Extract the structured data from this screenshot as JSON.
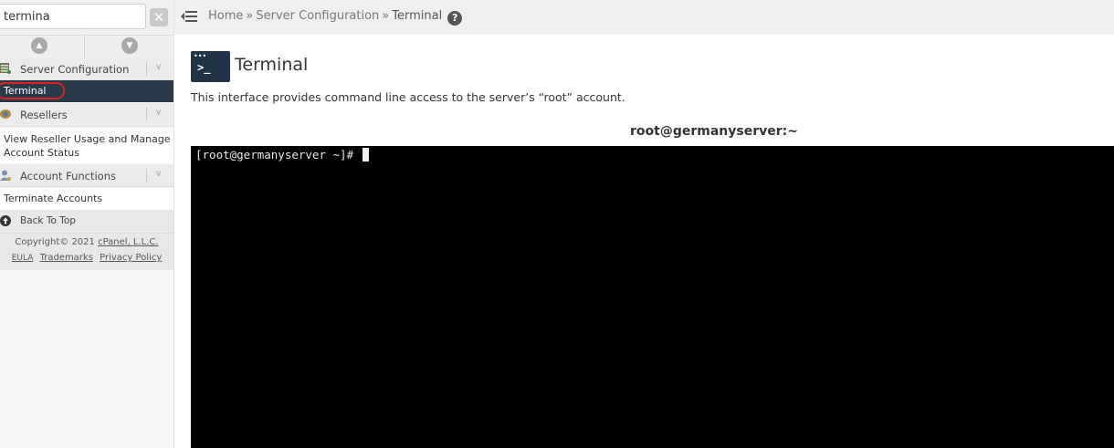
{
  "search": {
    "value": "termina",
    "clear_label": "✕"
  },
  "sidebar": {
    "collapse_up": "▲",
    "collapse_down": "▼",
    "categories": [
      {
        "label": "Server Configuration",
        "chevron": "∨",
        "icon": "server-config-icon",
        "items": [
          "Terminal"
        ]
      },
      {
        "label": "Resellers",
        "chevron": "∨",
        "icon": "resellers-icon",
        "items": [
          "View Reseller Usage and Manage Account Status"
        ]
      },
      {
        "label": "Account Functions",
        "chevron": "∨",
        "icon": "account-functions-icon",
        "items": [
          "Terminate Accounts"
        ]
      }
    ],
    "back_to_top": "Back To Top",
    "footer": {
      "copyright": "Copyright© 2021",
      "company": "cPanel, L.L.C.",
      "eula": "EULA",
      "trademarks": "Trademarks",
      "privacy": "Privacy Policy"
    }
  },
  "breadcrumb": {
    "home": "Home",
    "sep": "»",
    "section": "Server Configuration",
    "current": "Terminal",
    "help": "?"
  },
  "page": {
    "title": "Terminal",
    "description": "This interface provides command line access to the server’s “root” account.",
    "icon_prompt": ">_",
    "icon_dots": "•••"
  },
  "terminal": {
    "header": "root@germanyserver:~",
    "prompt": "[root@germanyserver ~]# "
  },
  "colors": {
    "selected_bg": "#293a4a",
    "highlight_circle": "#e0231b",
    "terminal_bg": "#000000"
  }
}
